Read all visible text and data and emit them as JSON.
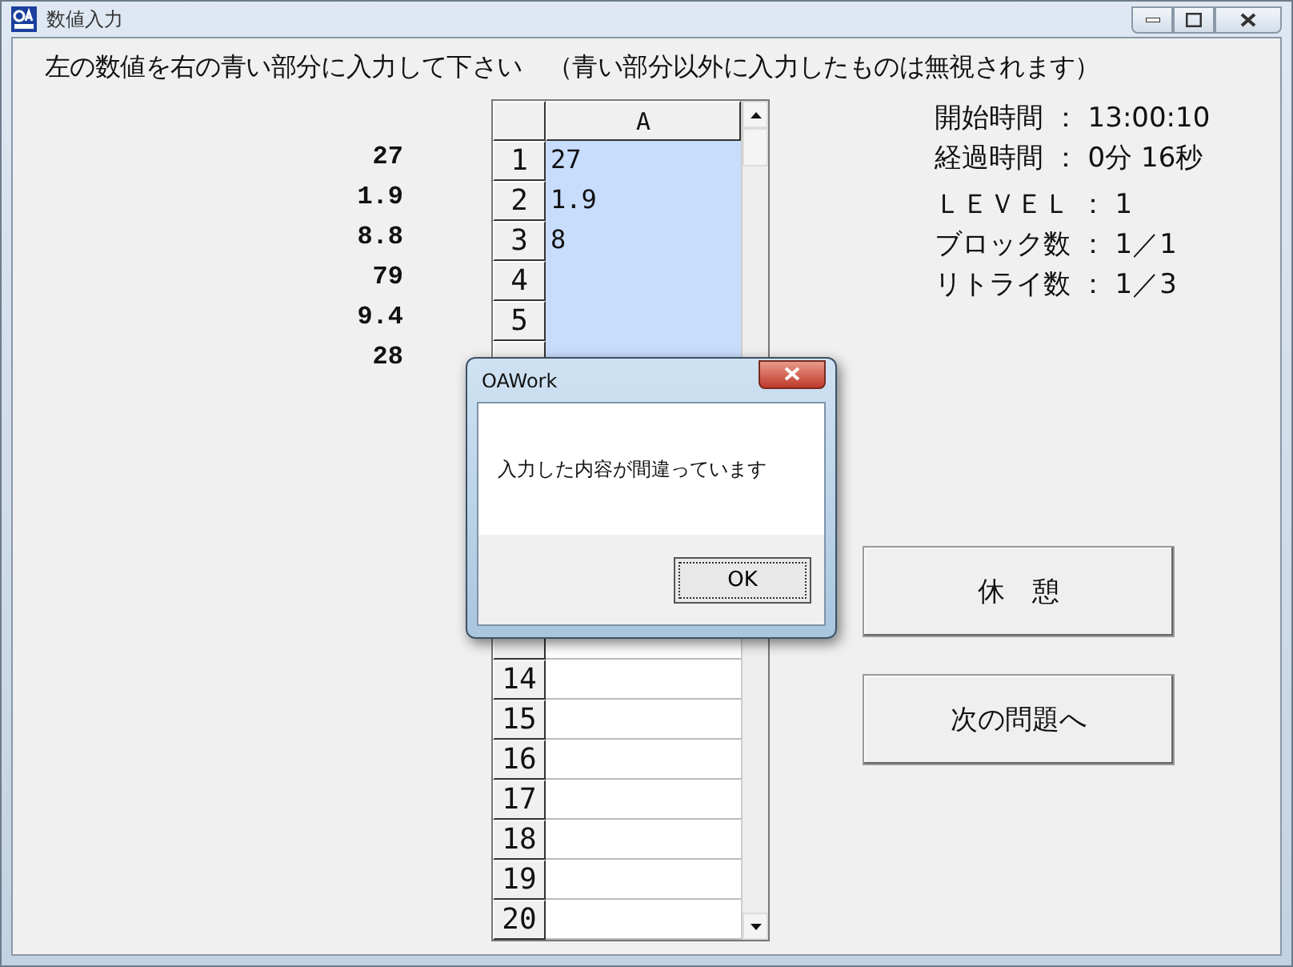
{
  "window": {
    "title": "数値入力"
  },
  "instruction": "左の数値を右の青い部分に入力して下さい　（青い部分以外に入力したものは無視されます）",
  "source_values": [
    "27",
    "1.9",
    "8.8",
    "79",
    "9.4",
    "28"
  ],
  "sheet": {
    "column_header": "A",
    "rows": [
      {
        "number": "1",
        "value": "27",
        "highlighted": true
      },
      {
        "number": "2",
        "value": "1.9",
        "highlighted": true
      },
      {
        "number": "3",
        "value": "8",
        "highlighted": true
      },
      {
        "number": "4",
        "highlighted": true
      },
      {
        "number": "5",
        "highlighted": true
      },
      {
        "highlighted": true
      },
      {},
      {},
      {},
      {},
      {},
      {},
      {
        "highlighted": false
      },
      {
        "number": "14",
        "highlighted": false
      },
      {
        "number": "15",
        "highlighted": false
      },
      {
        "number": "16",
        "highlighted": false
      },
      {
        "number": "17",
        "highlighted": false
      },
      {
        "number": "18",
        "highlighted": false
      },
      {
        "number": "19",
        "highlighted": false
      },
      {
        "number": "20",
        "highlighted": false
      }
    ]
  },
  "info": [
    "開始時間 ： 13:00:10",
    "経過時間 ： 0分 16秒",
    "ＬＥＶＥＬ ： 1",
    "ブロック数 ： 1／1",
    "リトライ数 ： 1／3"
  ],
  "buttons": [
    "休　憩",
    "次の問題へ"
  ],
  "dialog": {
    "title": "OAWork",
    "message": "入力した内容が間違っています",
    "button": "OK"
  }
}
